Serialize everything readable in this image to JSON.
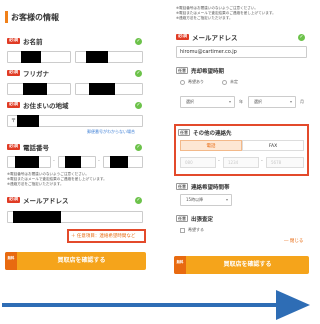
{
  "left": {
    "section_title": "お客様の情報",
    "fields": {
      "name": {
        "badge": "必須",
        "label": "お名前"
      },
      "furigana": {
        "badge": "必須",
        "label": "フリガナ"
      },
      "region": {
        "badge": "必須",
        "label": "お住まいの地域",
        "postal_prefix": "〒",
        "lookup_link": "郵便番号がわからない場合"
      },
      "phone": {
        "badge": "必須",
        "label": "電話番号",
        "notes": [
          "※電話番号はお間違いのないようご注意ください。",
          "※電話またはメールで査定結果のご連絡を差し上げています。",
          "※連絡方法をご指定いただけます。"
        ]
      },
      "email": {
        "badge": "必須",
        "label": "メールアドレス"
      }
    },
    "optional_toggle": "＋ 任意項目：連絡希望時間など",
    "cta": {
      "badge_line1": "無料",
      "badge_line2": "",
      "label": "買取店を確認する"
    }
  },
  "right": {
    "top_notes": [
      "※電話番号はお間違いのないようご注意ください。",
      "※電話またはメールで査定結果のご連絡を差し上げています。",
      "※連絡方法をご指定いただけます。"
    ],
    "email": {
      "badge": "必須",
      "label": "メールアドレス",
      "value": "hiromu@cartimer.co.jp"
    },
    "sell_timing": {
      "badge": "任意",
      "label": "売却希望時期",
      "options": [
        "希望あり",
        "未定"
      ],
      "year_select": "選択",
      "year_unit": "年",
      "month_select": "選択",
      "month_unit": "月"
    },
    "other_contact": {
      "badge": "任意",
      "label": "その他の連絡先",
      "tabs": [
        "電話",
        "FAX"
      ],
      "phone_placeholders": [
        "080",
        "1234",
        "5678"
      ]
    },
    "contact_time": {
      "badge": "任意",
      "label": "連絡希望時間帯",
      "select": "15時以降"
    },
    "visit": {
      "badge": "任意",
      "label": "出張査定",
      "option": "希望する"
    },
    "close_link": "― 閉じる",
    "cta": {
      "badge_line1": "無料",
      "badge_line2": "",
      "label": "買取店を確認する"
    }
  },
  "colors": {
    "accent": "#f5a41b",
    "accent_dark": "#e86a10",
    "required": "#e03b24",
    "check": "#6cc24a",
    "highlight": "#e34a2b",
    "arrow": "#2e6db5"
  },
  "icons": [
    "check-icon",
    "arrow-right-icon"
  ]
}
